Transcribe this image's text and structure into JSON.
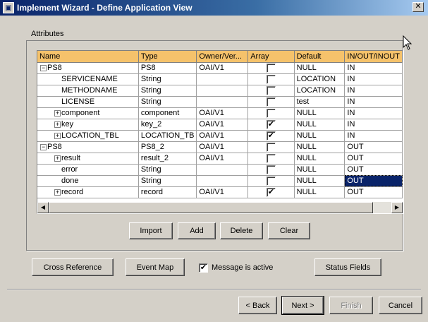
{
  "window": {
    "title": "Implement Wizard - Define Application View",
    "close_glyph": "✕"
  },
  "attributes": {
    "legend": "Attributes",
    "columns": [
      "Name",
      "Type",
      "Owner/Ver...",
      "Array",
      "Default",
      "IN/OUT/INOUT"
    ],
    "rows": [
      {
        "level": 0,
        "expander": "−",
        "name": "PS8",
        "type": "PS8",
        "owner": "OAI/V1",
        "array": false,
        "default": "NULL",
        "inout": "IN"
      },
      {
        "level": 1,
        "expander": "",
        "name": "SERVICENAME",
        "type": "String",
        "owner": "",
        "array": false,
        "default": "LOCATION",
        "inout": "IN"
      },
      {
        "level": 1,
        "expander": "",
        "name": "METHODNAME",
        "type": "String",
        "owner": "",
        "array": false,
        "default": "LOCATION",
        "inout": "IN"
      },
      {
        "level": 1,
        "expander": "",
        "name": "LICENSE",
        "type": "String",
        "owner": "",
        "array": false,
        "default": "test",
        "inout": "IN"
      },
      {
        "level": 1,
        "expander": "+",
        "name": "component",
        "type": "component",
        "owner": "OAI/V1",
        "array": false,
        "default": "NULL",
        "inout": "IN"
      },
      {
        "level": 1,
        "expander": "+",
        "name": "key",
        "type": "key_2",
        "owner": "OAI/V1",
        "array": true,
        "default": "NULL",
        "inout": "IN"
      },
      {
        "level": 1,
        "expander": "+",
        "name": "LOCATION_TBL",
        "type": "LOCATION_TB",
        "owner": "OAI/V1",
        "array": true,
        "default": "NULL",
        "inout": "IN"
      },
      {
        "level": 0,
        "expander": "−",
        "name": "PS8",
        "type": "PS8_2",
        "owner": "OAI/V1",
        "array": false,
        "default": "NULL",
        "inout": "OUT"
      },
      {
        "level": 1,
        "expander": "+",
        "name": "result",
        "type": "result_2",
        "owner": "OAI/V1",
        "array": false,
        "default": "NULL",
        "inout": "OUT"
      },
      {
        "level": 1,
        "expander": "",
        "name": "error",
        "type": "String",
        "owner": "",
        "array": false,
        "default": "NULL",
        "inout": "OUT"
      },
      {
        "level": 1,
        "expander": "",
        "name": "done",
        "type": "String",
        "owner": "",
        "array": false,
        "default": "NULL",
        "inout": "OUT",
        "selected_inout": true
      },
      {
        "level": 1,
        "expander": "+",
        "name": "record",
        "type": "record",
        "owner": "OAI/V1",
        "array": true,
        "default": "NULL",
        "inout": "OUT"
      }
    ],
    "check_glyph": "✔"
  },
  "table_buttons": {
    "import": "Import",
    "add": "Add",
    "delete": "Delete",
    "clear": "Clear"
  },
  "options": {
    "cross_reference": "Cross Reference",
    "event_map": "Event Map",
    "message_active_label": "Message is active",
    "message_active_checked": true,
    "status_fields": "Status Fields"
  },
  "nav": {
    "back": "< Back",
    "next": "Next >",
    "finish": "Finish",
    "cancel": "Cancel"
  },
  "scrollbar": {
    "left_glyph": "◀",
    "right_glyph": "▶"
  }
}
